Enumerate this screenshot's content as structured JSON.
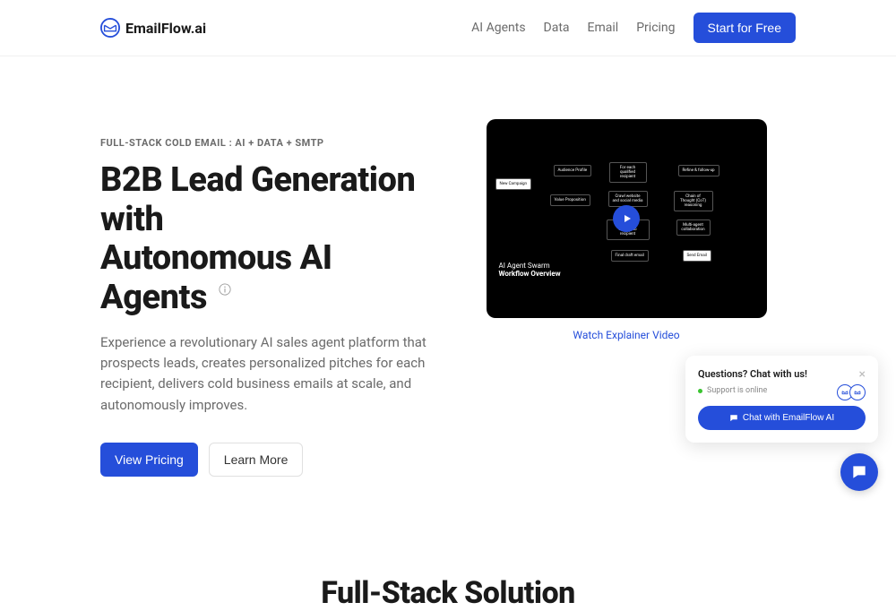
{
  "brand": {
    "name": "EmailFlow.ai"
  },
  "nav": {
    "items": [
      "AI Agents",
      "Data",
      "Email",
      "Pricing"
    ],
    "cta": "Start for Free"
  },
  "hero": {
    "eyebrow": "FULL-STACK COLD EMAIL : AI + DATA + SMTP",
    "title_line1": "B2B Lead Generation with",
    "title_line2": "Autonomous AI Agents",
    "description": "Experience a revolutionary AI sales agent platform that prospects leads, creates personalized pitches for each recipient, delivers cold business emails at scale, and autonomously improves.",
    "view_pricing": "View Pricing",
    "learn_more": "Learn More"
  },
  "video": {
    "subtitle": "AI Agent Swarm",
    "title": "Workflow Overview",
    "link": "Watch Explainer Video",
    "nodes": {
      "new_campaign": "New Campaign",
      "audience": "Audience Profile",
      "value_prop": "Value Proposition",
      "qualified": "For each qualified recipient",
      "refine": "Refine & follow-up",
      "crawl": "Crawl website and social media",
      "cot": "Chain of Thought (CoT) reasoning",
      "write": "Write email tailored to recipient",
      "multi": "Multi-agent collaboration",
      "final": "Final draft email",
      "send": "Send Email"
    }
  },
  "section2": {
    "title": "Full-Stack Solution"
  },
  "chat": {
    "title": "Questions? Chat with us!",
    "status": "Support is online",
    "button": "Chat with EmailFlow AI"
  }
}
